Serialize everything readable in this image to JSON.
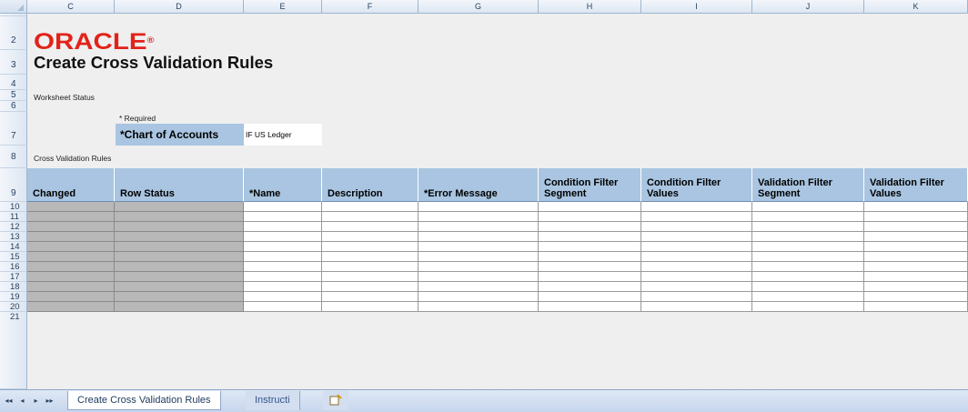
{
  "columns": [
    "C",
    "D",
    "E",
    "F",
    "G",
    "H",
    "I",
    "J",
    "K"
  ],
  "rows": [
    "2",
    "3",
    "4",
    "5",
    "6",
    "7",
    "8",
    "9",
    "10",
    "11",
    "12",
    "13",
    "14",
    "15",
    "16",
    "17",
    "18",
    "19",
    "20",
    "21"
  ],
  "logo": "ORACLE",
  "title": "Create Cross Validation Rules",
  "worksheet_status_label": "Worksheet Status",
  "required_label": "* Required",
  "chart_of_accounts_label": "*Chart of Accounts",
  "chart_of_accounts_value": "IF US Ledger",
  "section_label": "Cross Validation Rules",
  "table_headers": [
    "Changed",
    "Row Status",
    "*Name",
    "Description",
    "*Error Message",
    "Condition Filter Segment",
    "Condition Filter Values",
    "Validation Filter Segment",
    "Validation Filter Values"
  ],
  "sheet_tabs": {
    "active": "Create Cross Validation Rules",
    "other": "Instructi",
    "nav": [
      "◂◂",
      "◂",
      "▸",
      "▸▸"
    ]
  }
}
